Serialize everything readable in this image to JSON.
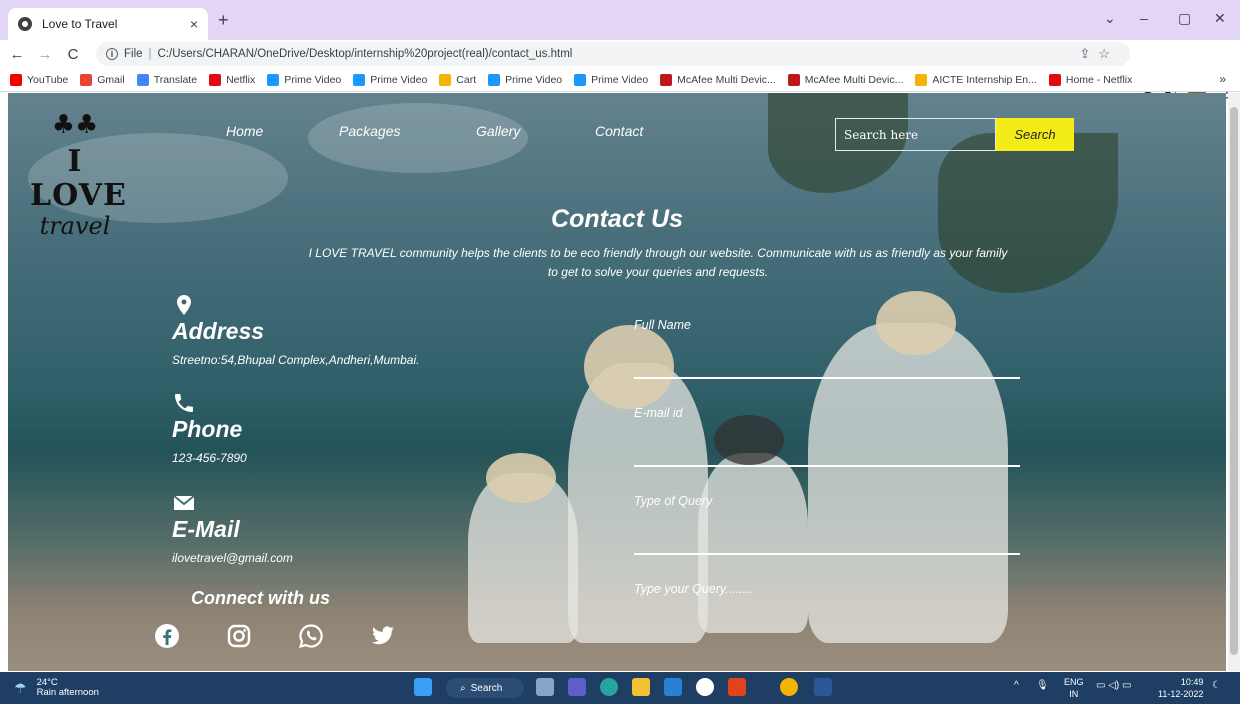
{
  "browser": {
    "tab_title": "Love to Travel",
    "tab_close": "×",
    "new_tab": "+",
    "file_label": "File",
    "url": "C:/Users/CHARAN/OneDrive/Desktop/internship%20project(real)/contact_us.html",
    "bookmarks": [
      {
        "label": "YouTube",
        "color": "#ff0000"
      },
      {
        "label": "Gmail",
        "color": "#ea4335"
      },
      {
        "label": "Translate",
        "color": "#4285f4"
      },
      {
        "label": "Netflix",
        "color": "#e50914"
      },
      {
        "label": "Prime Video",
        "color": "#1a98ff"
      },
      {
        "label": "Prime Video",
        "color": "#1a98ff"
      },
      {
        "label": "Cart",
        "color": "#f4b400"
      },
      {
        "label": "Prime Video",
        "color": "#1a98ff"
      },
      {
        "label": "Prime Video",
        "color": "#1a98ff"
      },
      {
        "label": "McAfee Multi Devic...",
        "color": "#c01818"
      },
      {
        "label": "McAfee Multi Devic...",
        "color": "#c01818"
      },
      {
        "label": "AICTE Internship En...",
        "color": "#f4b400"
      },
      {
        "label": "Home - Netflix",
        "color": "#e50914"
      }
    ]
  },
  "site": {
    "logo_line1": "I LOVE",
    "logo_line2": "travel",
    "nav": [
      "Home",
      "Packages",
      "Gallery",
      "Contact"
    ],
    "search_placeholder": "Search here",
    "search_button": "Search",
    "title": "Contact Us",
    "subtitle": "I LOVE TRAVEL community helps the clients to be eco friendly through our website. Communicate with us as friendly as your family to get to solve your queries and requests.",
    "address_head": "Address",
    "address_text": "Streetno:54,Bhupal Complex,Andheri,Mumbai.",
    "phone_head": "Phone",
    "phone_text": "123-456-7890",
    "email_head": "E-Mail",
    "email_text": "ilovetravel@gmail.com",
    "connect": "Connect with us",
    "form": {
      "full_name": "Full Name",
      "email": "E-mail id",
      "query_type": "Type of Query",
      "query": "Type your Query........"
    }
  },
  "taskbar": {
    "temp": "24°C",
    "weather": "Rain afternoon",
    "search": "Search",
    "lang1": "ENG",
    "lang2": "IN",
    "time": "10:49",
    "date": "11-12-2022"
  }
}
